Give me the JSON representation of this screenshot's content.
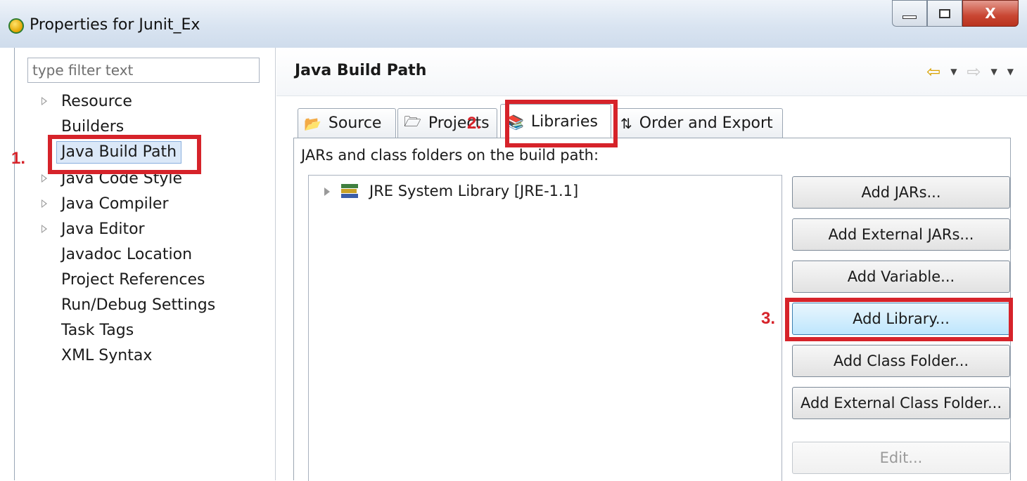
{
  "window": {
    "title": "Properties for Junit_Ex",
    "close_label": "X"
  },
  "sidebar": {
    "filter_placeholder": "type filter text",
    "items": [
      {
        "label": "Resource",
        "expandable": true
      },
      {
        "label": "Builders",
        "expandable": false
      },
      {
        "label": "Java Build Path",
        "expandable": false,
        "selected": true
      },
      {
        "label": "Java Code Style",
        "expandable": true
      },
      {
        "label": "Java Compiler",
        "expandable": true
      },
      {
        "label": "Java Editor",
        "expandable": true
      },
      {
        "label": "Javadoc Location",
        "expandable": false
      },
      {
        "label": "Project References",
        "expandable": false
      },
      {
        "label": "Run/Debug Settings",
        "expandable": false
      },
      {
        "label": "Task Tags",
        "expandable": false
      },
      {
        "label": "XML Syntax",
        "expandable": false
      }
    ]
  },
  "main": {
    "title": "Java Build Path",
    "tabs": [
      {
        "label": "Source",
        "icon": "source-folder-icon"
      },
      {
        "label": "Projects",
        "icon": "projects-folder-icon"
      },
      {
        "label": "Libraries",
        "icon": "libraries-icon",
        "active": true
      },
      {
        "label": "Order and Export",
        "icon": "order-export-icon"
      }
    ],
    "caption": "JARs and class folders on the build path:",
    "libraries": [
      {
        "label": "JRE System Library [JRE-1.1]",
        "icon": "library-icon"
      }
    ],
    "buttons": [
      {
        "label": "Add JARs...",
        "state": "normal"
      },
      {
        "label": "Add External JARs...",
        "state": "normal"
      },
      {
        "label": "Add Variable...",
        "state": "normal"
      },
      {
        "label": "Add Library...",
        "state": "hover"
      },
      {
        "label": "Add Class Folder...",
        "state": "normal"
      },
      {
        "label": "Add External Class Folder...",
        "state": "normal"
      },
      {
        "label": "Edit...",
        "state": "disabled"
      }
    ]
  },
  "annotations": {
    "step1": "1.",
    "step2": "2.",
    "step3": "3.",
    "color": "#d6232a"
  }
}
